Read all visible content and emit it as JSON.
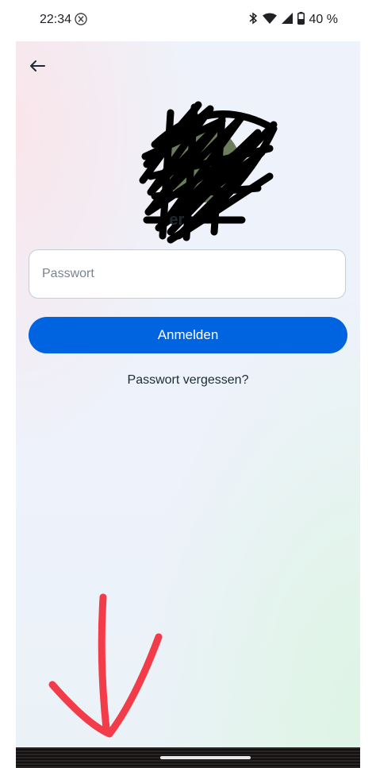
{
  "status_bar": {
    "time": "22:34",
    "battery": "40 %",
    "icons": [
      "x-app-icon",
      "bluetooth-icon",
      "wifi-icon",
      "signal-icon",
      "battery-icon"
    ]
  },
  "header": {
    "back_icon": "arrow-left-icon"
  },
  "profile": {
    "name_visible_fragment": "er"
  },
  "form": {
    "password_placeholder": "Passwort",
    "password_value": "",
    "login_label": "Anmelden",
    "forgot_label": "Passwort vergessen?"
  },
  "annotation": {
    "arrow_color": "#f23c4a"
  },
  "colors": {
    "accent": "#0064e0",
    "text": "#1c2b33"
  }
}
